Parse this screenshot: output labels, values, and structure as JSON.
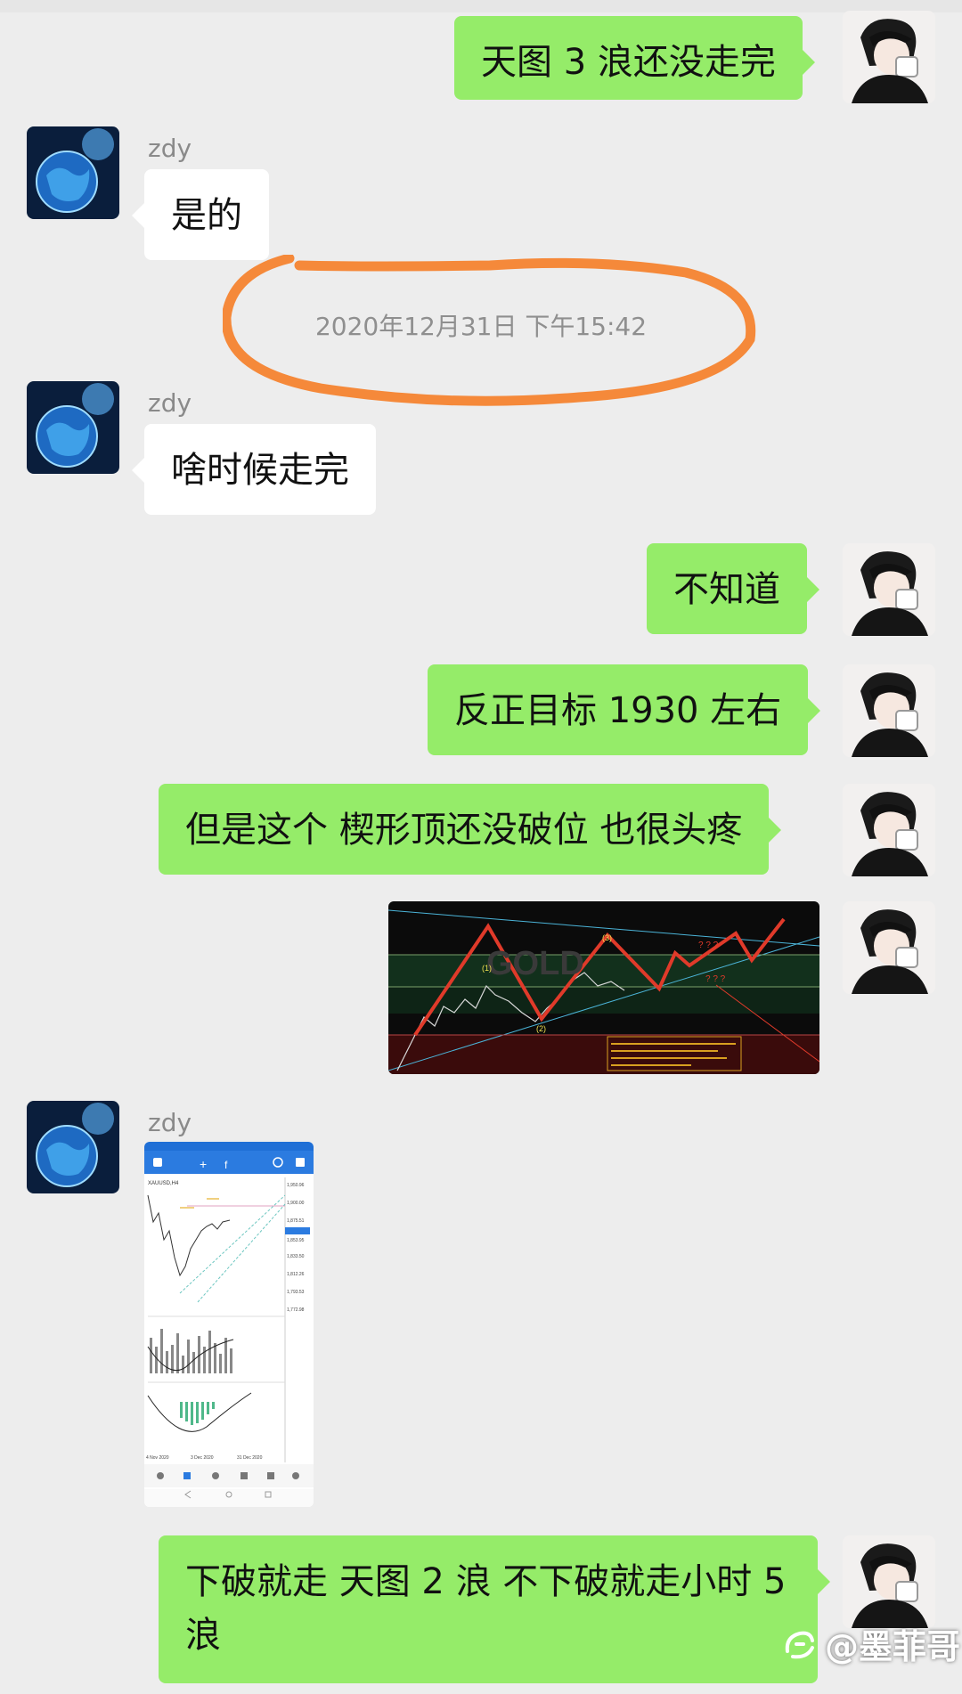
{
  "messages": [
    {
      "side": "right",
      "text": "天图 3 浪还没走完"
    },
    {
      "side": "left",
      "sender": "zdy",
      "text": "是的"
    },
    {
      "side": "left",
      "sender": "zdy",
      "text": "啥时候走完"
    },
    {
      "side": "right",
      "text": "不知道"
    },
    {
      "side": "right",
      "text": "反正目标 1930 左右"
    },
    {
      "side": "right",
      "text": "但是这个 楔形顶还没破位 也很头疼"
    },
    {
      "side": "left",
      "sender": "zdy",
      "type": "image"
    },
    {
      "side": "right",
      "text": "下破就走 天图 2 浪  不下破就走小时 5 浪"
    }
  ],
  "timestamp": "2020年12月31日 下午15:42",
  "chart_image": {
    "symbol": "GOLD",
    "annotations": [
      "(1)",
      "(2)",
      "(3)",
      "? ? ?",
      "? ? ?"
    ]
  },
  "phone_chart": {
    "ticker": "XAUUSD,H4",
    "price_labels": [
      "1,950.96",
      "1,900.00",
      "1,875.51",
      "1,853.95",
      "1,833.50",
      "1,812.26",
      "1,793.53",
      "1,772.98"
    ],
    "date_labels": [
      "4 Nov 2020",
      "3 Dec 2020",
      "31 Dec 2020"
    ]
  },
  "watermark": "@墨菲哥",
  "colors": {
    "bubble_right": "#95ec69",
    "bubble_left": "#ffffff",
    "background": "#ededed",
    "highlight_circle": "#f5893a"
  }
}
